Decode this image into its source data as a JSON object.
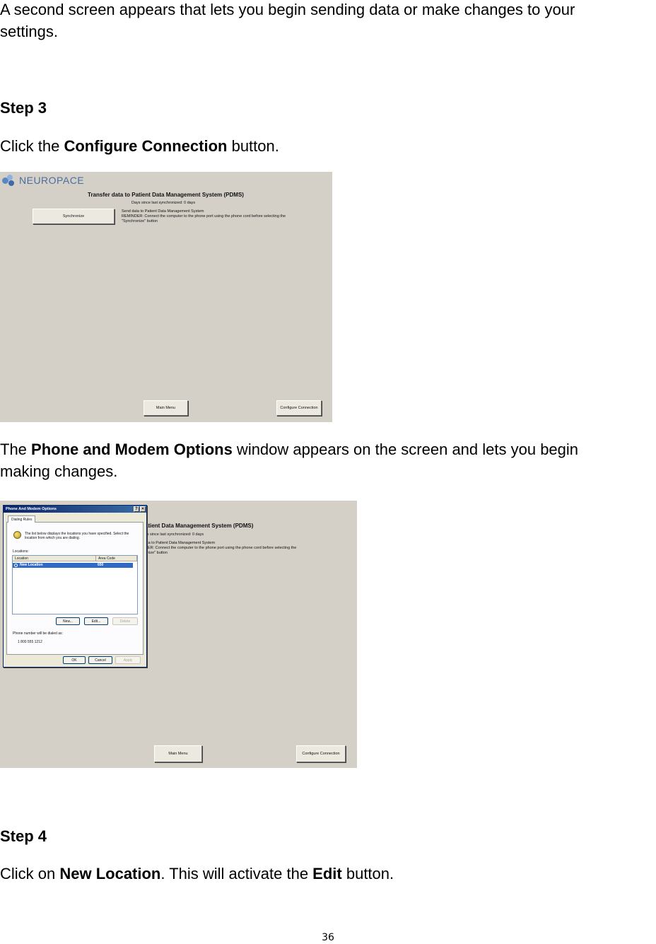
{
  "intro": {
    "line1": "A second screen appears that lets you begin sending data or make changes to your",
    "line2": "settings."
  },
  "step3": {
    "heading": "Step 3",
    "pre": "Click the ",
    "bold": "Configure Connection",
    "post": " button."
  },
  "screen1": {
    "logo_text": "NEUROPACE",
    "title": "Transfer data to Patient Data Management System (PDMS)",
    "days": "Days since last synchronized: 0 days",
    "synchronize": "Synchronize",
    "desc1": "Send data to Patient Data Management System",
    "desc2": "REMINDER: Connect the computer to the phone port using the phone cord before selecting the",
    "desc3": "\"Synchronize\" button",
    "main_menu": "Main Menu",
    "configure": "Configure Connection"
  },
  "phone_para": {
    "pre": "The ",
    "bold": "Phone and Modem Options",
    "post1": " window appears on the screen and lets you begin",
    "line2": "making changes."
  },
  "screen2": {
    "title_part": "atient Data Management System (PDMS)",
    "days_part": "ys since last synchronized: 0 days",
    "desc1_part": "ata to Patient Data Management System",
    "desc2_part": "DER: Connect the computer to the phone port using the phone cord before selecting the",
    "desc3_part": "onize\" button",
    "main_menu": "Main Menu",
    "configure": "Configure Connection",
    "dialog": {
      "title": "Phone And Modem Options",
      "help": "?",
      "close": "×",
      "tab": "Dialing Rules",
      "info1": "The list below displays the locations you have specified. Select the",
      "info2": "location from which you are dialing.",
      "locations_label": "Locations:",
      "col_location": "Location",
      "col_area": "Area Code",
      "row_location": "New Location",
      "row_area": "650",
      "btn_new": "New...",
      "btn_edit": "Edit...",
      "btn_delete": "Delete",
      "dialed_as": "Phone number will be dialed as:",
      "phone_number": "1 800 555 1212",
      "btn_ok": "OK",
      "btn_cancel": "Cancel",
      "btn_apply": "Apply"
    }
  },
  "step4": {
    "heading": "Step 4",
    "pre": "Click on ",
    "bold1": "New Location",
    "mid": ". This will activate the ",
    "bold2": "Edit",
    "post": " button."
  },
  "page_number": "36"
}
